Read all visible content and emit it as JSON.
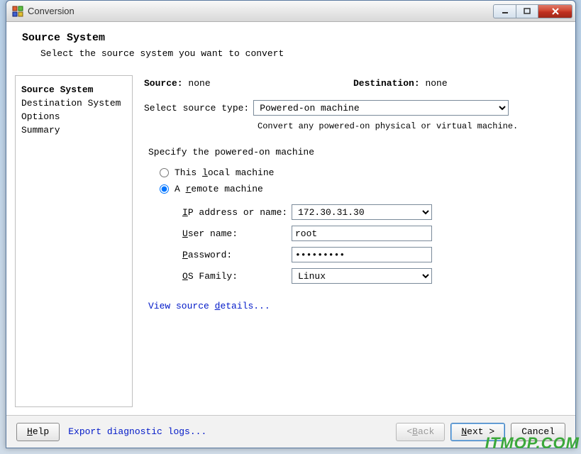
{
  "window": {
    "title": "Conversion"
  },
  "header": {
    "title": "Source System",
    "subtitle": "Select the source system you want to convert"
  },
  "sidebar": {
    "items": [
      {
        "label": "Source System",
        "active": true
      },
      {
        "label": "Destination System",
        "active": false
      },
      {
        "label": "Options",
        "active": false
      },
      {
        "label": "Summary",
        "active": false
      }
    ]
  },
  "main": {
    "source_label": "Source:",
    "source_value": "none",
    "dest_label": "Destination:",
    "dest_value": "none",
    "select_type_label": "Select source type:",
    "select_type_value": "Powered-on machine",
    "select_type_helper": "Convert any powered-on physical or virtual machine.",
    "group_title": "Specify the powered-on machine",
    "radio_local": "This local machine",
    "radio_remote": "A remote machine",
    "radio_selected": "remote",
    "ip_label": "IP address or name:",
    "ip_value": "172.30.31.30",
    "user_label": "User name:",
    "user_value": "root",
    "pass_label": "Password:",
    "pass_value": "•••••••••",
    "os_label": "OS Family:",
    "os_value": "Linux",
    "view_details": "View source details..."
  },
  "footer": {
    "help": "Help",
    "export": "Export diagnostic logs...",
    "back": "< Back",
    "next": "Next >",
    "cancel": "Cancel"
  },
  "watermark": "ITMOP.COM"
}
